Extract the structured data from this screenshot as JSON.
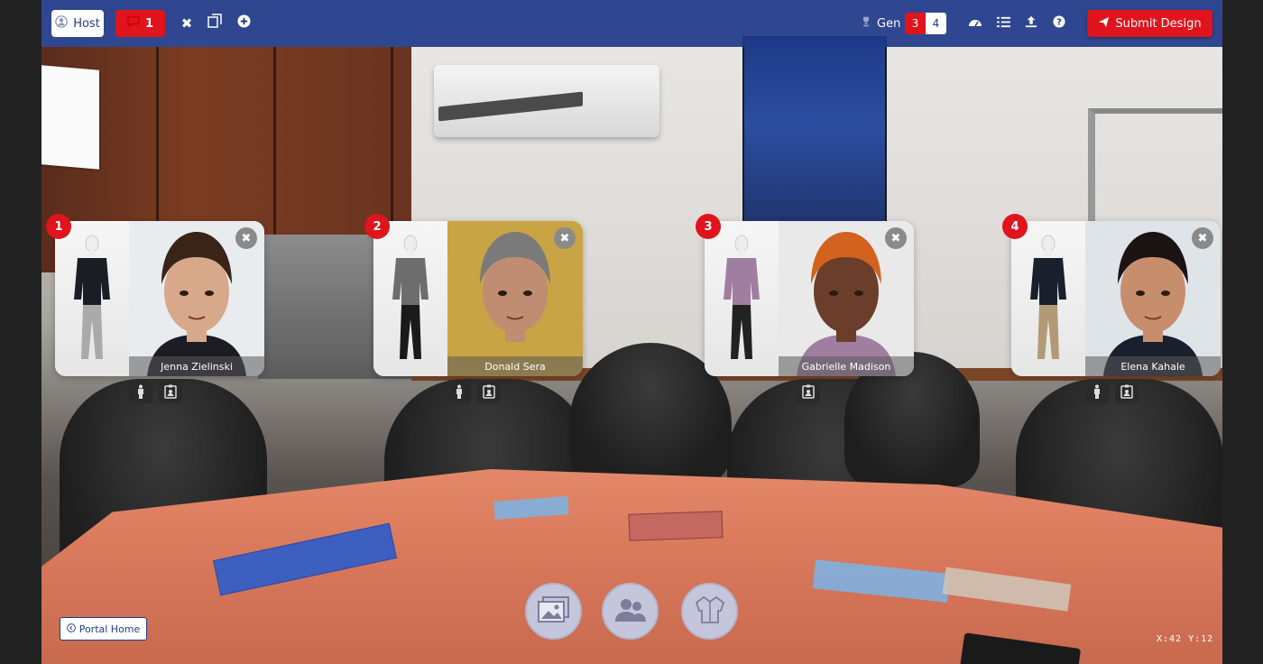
{
  "toolbar": {
    "host_label": "Host",
    "chat_count": "1",
    "gen_label": "Gen",
    "gen_options": [
      "3",
      "4"
    ],
    "submit_label": "Submit Design"
  },
  "cards": [
    {
      "number": "1",
      "name": "Jenna Zielinski",
      "outfit_color": "#1c1c24",
      "skirt_color": "#aaa",
      "skin": "#d8a88a",
      "hair": "#3a2418",
      "bg": "#e8ecef",
      "close": "✖"
    },
    {
      "number": "2",
      "name": "Donald Sera",
      "outfit_color": "#6d6d6d",
      "skirt_color": "#1a1a1a",
      "skin": "#c08c72",
      "hair": "#7a7a7a",
      "bg": "#c9a444",
      "close": "✖"
    },
    {
      "number": "3",
      "name": "Gabrielle Madison",
      "outfit_color": "#a07ea0",
      "skirt_color": "#222",
      "skin": "#6a3e2a",
      "hair": "#d2621e",
      "bg": "#e9e9e9",
      "close": "✖"
    },
    {
      "number": "4",
      "name": "Elena Kahale",
      "outfit_color": "#1a1f2e",
      "skirt_color": "#b29a76",
      "skin": "#c78e6e",
      "hair": "#1c1414",
      "bg": "#dfe4e8",
      "close": "✖"
    }
  ],
  "bottom": {
    "portal_label": "Portal Home",
    "coord_text": "X:42 Y:12"
  },
  "colors": {
    "accent_red": "#e0141c",
    "toolbar_blue": "#1f3a8c"
  }
}
